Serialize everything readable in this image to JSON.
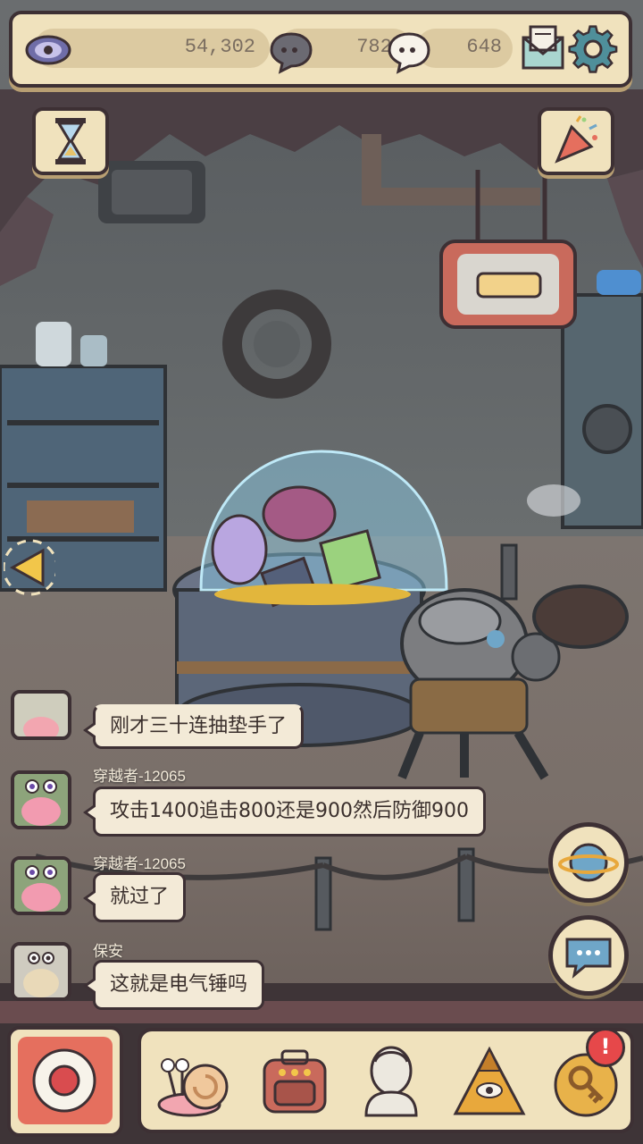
{
  "currencies": {
    "eye_amount": "54,302",
    "gray_bubble_amount": "7824",
    "white_bubble_amount": "648"
  },
  "chat": {
    "messages": [
      {
        "name": "",
        "text": "刚才三十连抽垫手了"
      },
      {
        "name": "穿越者-12065",
        "text": "攻击1400追击800还是900然后防御900"
      },
      {
        "name": "穿越者-12065",
        "text": "就过了"
      },
      {
        "name": "保安",
        "text": "这就是电气锤吗"
      }
    ]
  },
  "notification_badge": "!",
  "colors": {
    "panel": "#f0e2bd",
    "outline": "#3d3034",
    "badge": "#e6484a",
    "accent_blue": "#6fa6c8"
  },
  "icons": {
    "currency": [
      "eye-icon",
      "gray-bubble-icon",
      "white-bubble-icon"
    ],
    "top": [
      "mail-icon",
      "settings-gear-icon",
      "hourglass-icon",
      "party-popper-icon"
    ],
    "dock": [
      "snail-icon",
      "backpack-icon",
      "statue-icon",
      "pyramid-eye-icon",
      "key-icon"
    ]
  }
}
